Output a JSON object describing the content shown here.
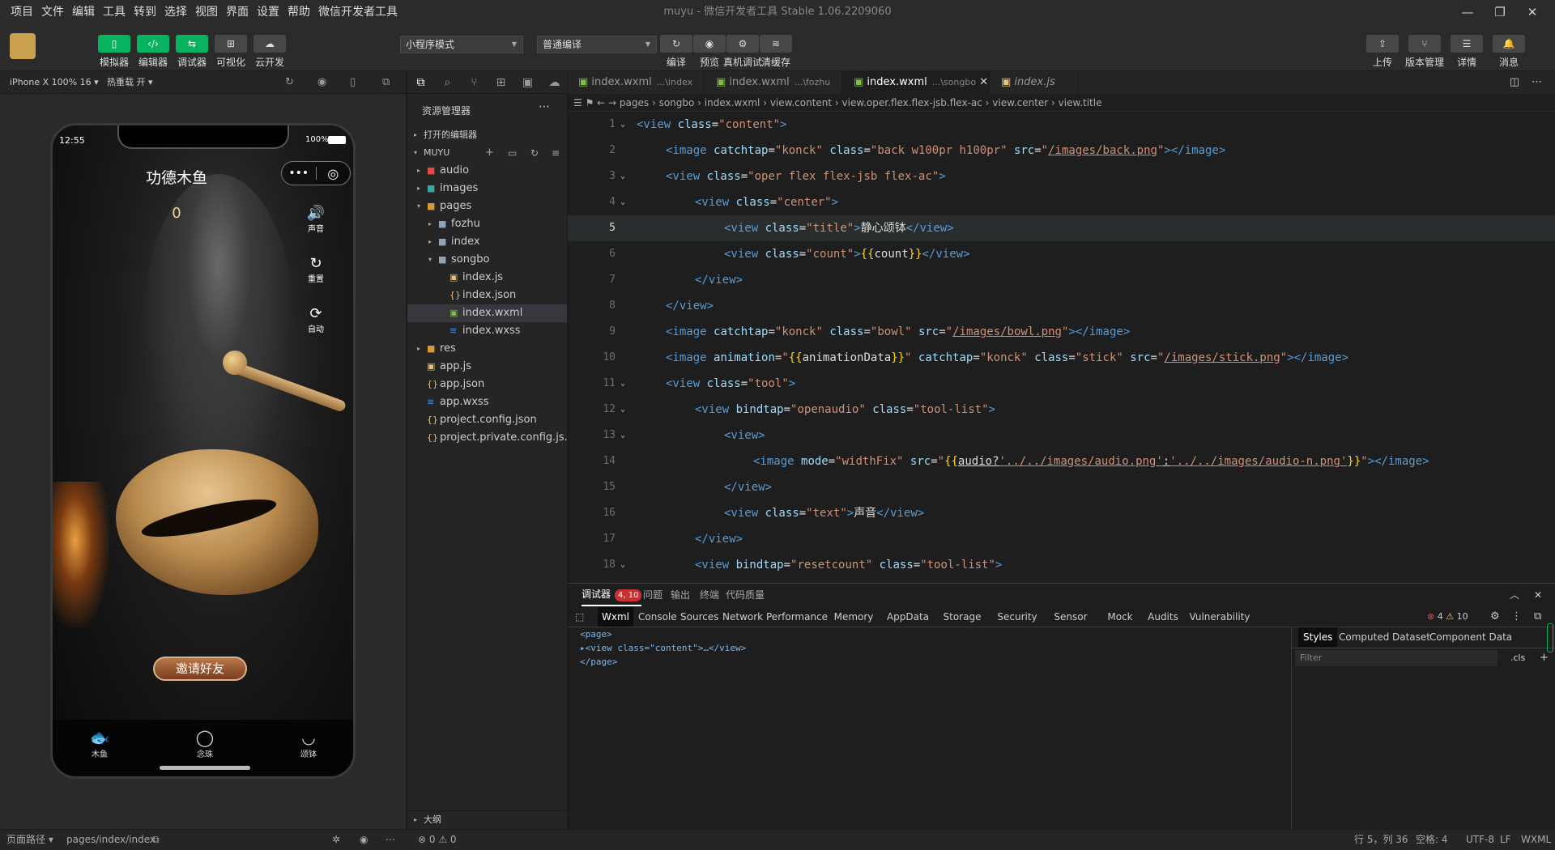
{
  "menu": [
    "项目",
    "文件",
    "编辑",
    "工具",
    "转到",
    "选择",
    "视图",
    "界面",
    "设置",
    "帮助",
    "微信开发者工具"
  ],
  "window_title": "muyu - 微信开发者工具 Stable 1.06.2209060",
  "toolbar": {
    "left_buttons": [
      {
        "label": "模拟器",
        "icon": "▯"
      },
      {
        "label": "编辑器",
        "icon": "‹/›"
      },
      {
        "label": "调试器",
        "icon": "⇆"
      },
      {
        "label": "可视化",
        "icon": "⊞"
      },
      {
        "label": "云开发",
        "icon": "☁"
      }
    ],
    "mode_select": "小程序模式",
    "compile_select": "普通编译",
    "mid_buttons": [
      {
        "label": "编译",
        "icon": "↻"
      },
      {
        "label": "预览",
        "icon": "◉"
      },
      {
        "label": "真机调试",
        "icon": "⚙"
      },
      {
        "label": "清缓存",
        "icon": "≋"
      }
    ],
    "right_buttons": [
      {
        "label": "上传",
        "icon": "⇪"
      },
      {
        "label": "版本管理",
        "icon": "⑂"
      },
      {
        "label": "详情",
        "icon": "☰"
      },
      {
        "label": "消息",
        "icon": "🔔"
      }
    ]
  },
  "simulator": {
    "device": "iPhone X 100% 16",
    "hot_reload": "热重载 开",
    "phone": {
      "time": "12:55",
      "battery": "100%",
      "title": "功德木鱼",
      "count": "0",
      "side_tools": [
        "声音",
        "重置",
        "自动"
      ],
      "invite_button": "邀请好友",
      "tabs": [
        "木鱼",
        "念珠",
        "颂钵"
      ]
    }
  },
  "explorer": {
    "title": "资源管理器",
    "open_editors": "打开的编辑器",
    "project": "MUYU",
    "tree": [
      {
        "name": "audio",
        "depth": 1,
        "type": "folder",
        "arrow": "▸",
        "color": "#e24a4a"
      },
      {
        "name": "images",
        "depth": 1,
        "type": "folder",
        "arrow": "▸",
        "color": "#3aa8a0"
      },
      {
        "name": "pages",
        "depth": 1,
        "type": "folder",
        "arrow": "▾",
        "color": "#d89b3a"
      },
      {
        "name": "fozhu",
        "depth": 2,
        "type": "folder",
        "arrow": "▸",
        "color": "#8da3b8"
      },
      {
        "name": "index",
        "depth": 2,
        "type": "folder",
        "arrow": "▸",
        "color": "#8da3b8"
      },
      {
        "name": "songbo",
        "depth": 2,
        "type": "folder",
        "arrow": "▾",
        "color": "#8da3b8"
      },
      {
        "name": "index.js",
        "depth": 3,
        "type": "js",
        "arrow": "",
        "color": "#e5c07b"
      },
      {
        "name": "index.json",
        "depth": 3,
        "type": "json",
        "arrow": "",
        "color": "#e5c07b"
      },
      {
        "name": "index.wxml",
        "depth": 3,
        "type": "wxml",
        "arrow": "",
        "color": "#7ec04a",
        "selected": true
      },
      {
        "name": "index.wxss",
        "depth": 3,
        "type": "wxss",
        "arrow": "",
        "color": "#4a8fd8"
      },
      {
        "name": "res",
        "depth": 1,
        "type": "folder",
        "arrow": "▸",
        "color": "#d89b3a"
      },
      {
        "name": "app.js",
        "depth": 1,
        "type": "js",
        "arrow": "",
        "color": "#e5c07b"
      },
      {
        "name": "app.json",
        "depth": 1,
        "type": "json",
        "arrow": "",
        "color": "#e5c07b"
      },
      {
        "name": "app.wxss",
        "depth": 1,
        "type": "wxss",
        "arrow": "",
        "color": "#4a8fd8"
      },
      {
        "name": "project.config.json",
        "depth": 1,
        "type": "json",
        "arrow": "",
        "color": "#e5c07b"
      },
      {
        "name": "project.private.config.js...",
        "depth": 1,
        "type": "json",
        "arrow": "",
        "color": "#e5c07b"
      }
    ],
    "outline": "大纲"
  },
  "editor": {
    "tabs": [
      {
        "name": "index.wxml",
        "path": "...\\index",
        "active": false
      },
      {
        "name": "index.wxml",
        "path": "...\\fozhu",
        "active": false
      },
      {
        "name": "index.wxml",
        "path": "...\\songbo",
        "active": true
      },
      {
        "name": "index.js",
        "path": "",
        "active": false
      }
    ],
    "breadcrumb": [
      "pages",
      "songbo",
      "index.wxml",
      "view.content",
      "view.oper.flex.flex-jsb.flex-ac",
      "view.center",
      "view.title"
    ],
    "current_line": 5,
    "lines": [
      {
        "n": 1,
        "indent": 0,
        "fold": true,
        "parts": [
          [
            "t1",
            "<view "
          ],
          [
            "at",
            "class"
          ],
          [
            "pl",
            "="
          ],
          [
            "sv",
            "\"content\""
          ],
          [
            "t1",
            ">"
          ]
        ]
      },
      {
        "n": 2,
        "indent": 1,
        "fold": false,
        "parts": [
          [
            "t1",
            "<image "
          ],
          [
            "at",
            "catchtap"
          ],
          [
            "pl",
            "="
          ],
          [
            "sv",
            "\"konck\" "
          ],
          [
            "at",
            "class"
          ],
          [
            "pl",
            "="
          ],
          [
            "sv",
            "\"back w100pr h100pr\" "
          ],
          [
            "at",
            "src"
          ],
          [
            "pl",
            "="
          ],
          [
            "sv",
            "\""
          ],
          [
            "sv ul",
            "/images/back.png"
          ],
          [
            "sv",
            "\""
          ],
          [
            "t1",
            "></image>"
          ]
        ]
      },
      {
        "n": 3,
        "indent": 1,
        "fold": true,
        "parts": [
          [
            "t1",
            "<view "
          ],
          [
            "at",
            "class"
          ],
          [
            "pl",
            "="
          ],
          [
            "sv",
            "\"oper flex flex-jsb flex-ac\""
          ],
          [
            "t1",
            ">"
          ]
        ]
      },
      {
        "n": 4,
        "indent": 2,
        "fold": true,
        "parts": [
          [
            "t1",
            "<view "
          ],
          [
            "at",
            "class"
          ],
          [
            "pl",
            "="
          ],
          [
            "sv",
            "\"center\""
          ],
          [
            "t1",
            ">"
          ]
        ]
      },
      {
        "n": 5,
        "indent": 3,
        "fold": false,
        "parts": [
          [
            "t1",
            "<view "
          ],
          [
            "at",
            "class"
          ],
          [
            "pl",
            "="
          ],
          [
            "sv",
            "\"title\""
          ],
          [
            "t1",
            ">"
          ],
          [
            "pl",
            "静心颂钵"
          ],
          [
            "t1",
            "</view>"
          ]
        ]
      },
      {
        "n": 6,
        "indent": 3,
        "fold": false,
        "parts": [
          [
            "t1",
            "<view "
          ],
          [
            "at",
            "class"
          ],
          [
            "pl",
            "="
          ],
          [
            "sv",
            "\"count\""
          ],
          [
            "t1",
            ">"
          ],
          [
            "br",
            "{{"
          ],
          [
            "pl",
            "count"
          ],
          [
            "br",
            "}}"
          ],
          [
            "t1",
            "</view>"
          ]
        ]
      },
      {
        "n": 7,
        "indent": 2,
        "fold": false,
        "parts": [
          [
            "t1",
            "</view>"
          ]
        ]
      },
      {
        "n": 8,
        "indent": 1,
        "fold": false,
        "parts": [
          [
            "t1",
            "</view>"
          ]
        ]
      },
      {
        "n": 9,
        "indent": 1,
        "fold": false,
        "parts": [
          [
            "t1",
            "<image "
          ],
          [
            "at",
            "catchtap"
          ],
          [
            "pl",
            "="
          ],
          [
            "sv",
            "\"konck\" "
          ],
          [
            "at",
            "class"
          ],
          [
            "pl",
            "="
          ],
          [
            "sv",
            "\"bowl\" "
          ],
          [
            "at",
            "src"
          ],
          [
            "pl",
            "="
          ],
          [
            "sv",
            "\""
          ],
          [
            "sv ul",
            "/images/bowl.png"
          ],
          [
            "sv",
            "\""
          ],
          [
            "t1",
            "></image>"
          ]
        ]
      },
      {
        "n": 10,
        "indent": 1,
        "fold": false,
        "parts": [
          [
            "t1",
            "<image "
          ],
          [
            "at",
            "animation"
          ],
          [
            "pl",
            "="
          ],
          [
            "sv",
            "\""
          ],
          [
            "br",
            "{{"
          ],
          [
            "pl",
            "animationData"
          ],
          [
            "br",
            "}}"
          ],
          [
            "sv",
            "\" "
          ],
          [
            "at",
            "catchtap"
          ],
          [
            "pl",
            "="
          ],
          [
            "sv",
            "\"konck\" "
          ],
          [
            "at",
            "class"
          ],
          [
            "pl",
            "="
          ],
          [
            "sv",
            "\"stick\" "
          ],
          [
            "at",
            "src"
          ],
          [
            "pl",
            "="
          ],
          [
            "sv",
            "\""
          ],
          [
            "sv ul",
            "/images/stick.png"
          ],
          [
            "sv",
            "\""
          ],
          [
            "t1",
            "></image>"
          ]
        ]
      },
      {
        "n": 11,
        "indent": 1,
        "fold": true,
        "parts": [
          [
            "t1",
            "<view "
          ],
          [
            "at",
            "class"
          ],
          [
            "pl",
            "="
          ],
          [
            "sv",
            "\"tool\""
          ],
          [
            "t1",
            ">"
          ]
        ]
      },
      {
        "n": 12,
        "indent": 2,
        "fold": true,
        "parts": [
          [
            "t1",
            "<view "
          ],
          [
            "at",
            "bindtap"
          ],
          [
            "pl",
            "="
          ],
          [
            "sv",
            "\"openaudio\" "
          ],
          [
            "at",
            "class"
          ],
          [
            "pl",
            "="
          ],
          [
            "sv",
            "\"tool-list\""
          ],
          [
            "t1",
            ">"
          ]
        ]
      },
      {
        "n": 13,
        "indent": 3,
        "fold": true,
        "parts": [
          [
            "t1",
            "<view>"
          ]
        ]
      },
      {
        "n": 14,
        "indent": 4,
        "fold": false,
        "parts": [
          [
            "t1",
            "<image "
          ],
          [
            "at",
            "mode"
          ],
          [
            "pl",
            "="
          ],
          [
            "sv",
            "\"widthFix\" "
          ],
          [
            "at",
            "src"
          ],
          [
            "pl",
            "="
          ],
          [
            "sv",
            "\""
          ],
          [
            "br",
            "{{"
          ],
          [
            "pl ul",
            "audio?"
          ],
          [
            "sv ul",
            "'../../images/audio.png'"
          ],
          [
            "pl ul",
            ":"
          ],
          [
            "sv ul",
            "'../../images/audio-n.png'"
          ],
          [
            "br",
            "}}"
          ],
          [
            "sv",
            "\""
          ],
          [
            "t1",
            "></image>"
          ]
        ]
      },
      {
        "n": 15,
        "indent": 3,
        "fold": false,
        "parts": [
          [
            "t1",
            "</view>"
          ]
        ]
      },
      {
        "n": 16,
        "indent": 3,
        "fold": false,
        "parts": [
          [
            "t1",
            "<view "
          ],
          [
            "at",
            "class"
          ],
          [
            "pl",
            "="
          ],
          [
            "sv",
            "\"text\""
          ],
          [
            "t1",
            ">"
          ],
          [
            "pl",
            "声音"
          ],
          [
            "t1",
            "</view>"
          ]
        ]
      },
      {
        "n": 17,
        "indent": 2,
        "fold": false,
        "parts": [
          [
            "t1",
            "</view>"
          ]
        ]
      },
      {
        "n": 18,
        "indent": 2,
        "fold": true,
        "parts": [
          [
            "t1",
            "<view "
          ],
          [
            "at",
            "bindtap"
          ],
          [
            "pl",
            "="
          ],
          [
            "sv",
            "\"resetcount\" "
          ],
          [
            "at",
            "class"
          ],
          [
            "pl",
            "="
          ],
          [
            "sv",
            "\"tool-list\""
          ],
          [
            "t1",
            ">"
          ]
        ]
      }
    ]
  },
  "devtools": {
    "top_tabs": [
      "调试器",
      "问题",
      "输出",
      "终端",
      "代码质量"
    ],
    "debugger_badge": "4, 10",
    "panel_tabs": [
      "Wxml",
      "Console",
      "Sources",
      "Network",
      "Performance",
      "Memory",
      "AppData",
      "Storage",
      "Security",
      "Sensor",
      "Mock",
      "Audits",
      "Vulnerability"
    ],
    "errors": "4",
    "warnings": "10",
    "dom_lines": [
      "<page>",
      "▸<view class=\"content\">…</view>",
      "</page>"
    ],
    "style_tabs": [
      "Styles",
      "Computed",
      "Dataset",
      "Component Data"
    ],
    "filter_placeholder": "Filter",
    "cls": ".cls"
  },
  "status": {
    "page_path_label": "页面路径",
    "page_path": "pages/index/index",
    "problems": "⊗ 0 ⚠ 0",
    "cursor": "行 5，列 36",
    "spaces": "空格: 4",
    "encoding": "UTF-8",
    "eol": "LF",
    "language": "WXML"
  }
}
